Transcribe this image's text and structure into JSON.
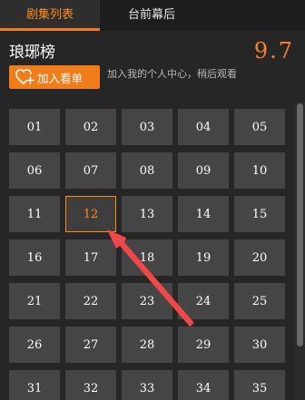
{
  "tabs": [
    {
      "label": "剧集列表",
      "active": true
    },
    {
      "label": "台前幕后",
      "active": false
    }
  ],
  "show": {
    "title": "琅琊榜",
    "score": "9.7"
  },
  "actions": {
    "add_label": "加入看单",
    "add_icon": "heart-plus-icon",
    "hint": "加入我的个人中心，稍后观看"
  },
  "episodes": {
    "items": [
      "01",
      "02",
      "03",
      "04",
      "05",
      "06",
      "07",
      "08",
      "09",
      "10",
      "11",
      "12",
      "13",
      "14",
      "15",
      "16",
      "17",
      "18",
      "19",
      "20",
      "21",
      "22",
      "23",
      "24",
      "25",
      "26",
      "27",
      "28",
      "29",
      "30",
      "31",
      "32",
      "33",
      "34",
      "35"
    ],
    "selected": "12"
  },
  "colors": {
    "accent": "#f07d1a",
    "active_text": "#ff8c1a",
    "tile_bg": "#454545",
    "page_bg": "#262626",
    "annotation_arrow": "#f04848"
  }
}
